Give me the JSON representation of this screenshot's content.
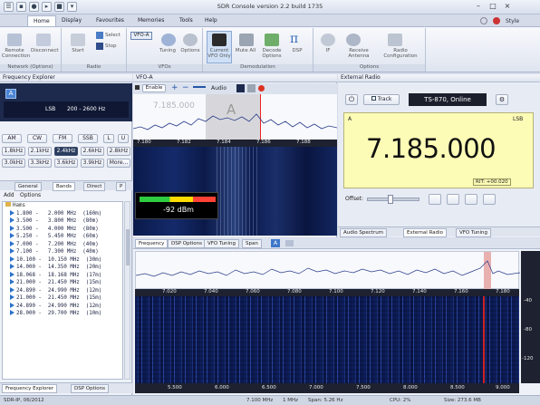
{
  "app": {
    "title": "SDR Console version 2.2 build 1735",
    "style_label": "Style"
  },
  "ribbon_tabs": [
    "Home",
    "Display",
    "Favourites",
    "Memories",
    "Tools",
    "Help"
  ],
  "ribbon": {
    "network_group": {
      "label": "Network (Options)",
      "btn1": "Remote Connection",
      "btn2": "Disconnect"
    },
    "radio_group": {
      "label": "Radio",
      "start": "Start",
      "select": "Select",
      "stop": "Stop"
    },
    "vfo_group": {
      "label": "VFOs",
      "vfo_tag": "VFO-A",
      "tuning": "Tuning",
      "options": "Options"
    },
    "demod_group": {
      "label": "Demodulation",
      "current": "Current VFO Only",
      "mute": "Mute All",
      "decode": "Decode Options",
      "dsp": "DSP"
    },
    "options_group": {
      "label": "Options",
      "btn1": "IF",
      "btn2": "Receive Antenna",
      "btn3": "Radio Configuration"
    }
  },
  "freq_explorer": {
    "title": "Frequency Explorer",
    "mode_label": "LSB",
    "range": "200 - 2600 Hz",
    "modes": [
      "AM",
      "CW",
      "FM",
      "SSB",
      "L",
      "U"
    ],
    "bw_row1": [
      "1.8kHz",
      "2.1kHz",
      "2.4kHz",
      "2.6kHz",
      "2.8kHz"
    ],
    "bw_row2": [
      "3.0kHz",
      "3.3kHz",
      "3.6kHz",
      "3.9kHz",
      "More..."
    ],
    "tabs": [
      "General",
      "Bands",
      "Direct",
      "P"
    ],
    "list_toolbar": {
      "add": "Add",
      "options": "Options"
    },
    "list_header": "Hams",
    "bands": [
      "1.800 -   2.000 MHz  (160m)",
      "3.500 -   3.800 MHz  (80m)",
      "3.500 -   4.000 MHz  (80m)",
      "5.250 -   5.450 MHz  (60m)",
      "7.000 -   7.200 MHz  (40m)",
      "7.100 -   7.300 MHz  (40m)",
      "10.100 -  10.150 MHz  (30m)",
      "14.000 -  14.350 MHz  (20m)",
      "18.068 -  18.168 MHz  (17m)",
      "21.000 -  21.450 MHz  (15m)",
      "24.890 -  24.990 MHz  (12m)",
      "21.000 -  21.450 MHz  (15m)",
      "24.890 -  24.990 MHz  (12m)",
      "28.000 -  29.700 MHz  (10m)"
    ],
    "bottom_tabs": [
      "Frequency Explorer",
      "DSP Options"
    ]
  },
  "vfo_panel": {
    "title": "VFO-A",
    "enable": "Enable",
    "audio": "Audio",
    "freq_overlay": "7.185.000",
    "vfo_letter": "A",
    "signal": "-92 dBm",
    "axis": [
      "7.180",
      "7.182",
      "7.184",
      "7.186",
      "7.188"
    ]
  },
  "external_radio": {
    "title": "External Radio",
    "track": "Track",
    "radio_name": "TS-870, Online",
    "vfo_letter": "A",
    "mode": "LSB",
    "frequency": "7.185.000",
    "rit": "RIT: +00.020",
    "offset_label": "Offset:",
    "bottom_tabs": [
      "Audio Spectrum",
      "External Radio",
      "VFO Tuning"
    ]
  },
  "spectrum": {
    "tabs": [
      "Frequency",
      "DSP Options",
      "VFO Tuning",
      "Span"
    ],
    "axis_top": [
      "7.020",
      "7.040",
      "7.060",
      "7.080",
      "7.100",
      "7.120",
      "7.140",
      "7.160",
      "7.180"
    ],
    "axis_bottom": [
      "5.500",
      "6.000",
      "6.500",
      "7.000",
      "7.500",
      "8.000",
      "8.500",
      "9.000"
    ],
    "db_labels": [
      "-40",
      "-80",
      "-120"
    ]
  },
  "status_bar": {
    "left": "SDR-IP, 06/2012",
    "center_freq": "7.100 MHz",
    "step": "1 MHz",
    "span": "Span: 5.26 Hz",
    "cpu": "CPU: 2%",
    "size": "Size: 273.6 MB"
  }
}
